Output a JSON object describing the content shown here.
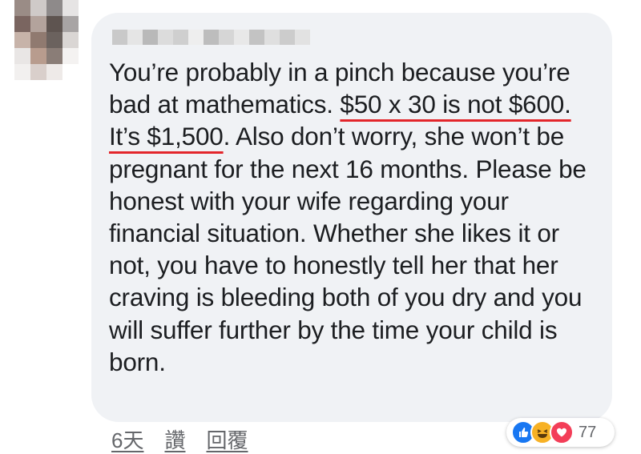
{
  "comment": {
    "text_1": "You’re probably in a pinch because you’re bad at mathematics. ",
    "highlight": "$50 x 30 is not $600. It’s $1,500",
    "text_2": ". Also don’t worry, she won’t be pregnant for the next 16 months. Please be honest with your wife regarding your financial situation. Whether she likes it or not, you have to honestly tell her that her craving is bleeding both of you dry and you will suffer further by the time your child is born."
  },
  "footer": {
    "time": "6天",
    "like_label": "讚",
    "reply_label": "回覆"
  },
  "reactions": {
    "icons": [
      "like-icon",
      "haha-icon",
      "love-icon"
    ],
    "count": "77",
    "colors": {
      "like": "#1877f2",
      "haha": "#f7b125",
      "love": "#f33e58"
    }
  },
  "colors": {
    "bubble": "#f0f2f5",
    "underline": "#e3262b",
    "meta_text": "#65676b"
  }
}
